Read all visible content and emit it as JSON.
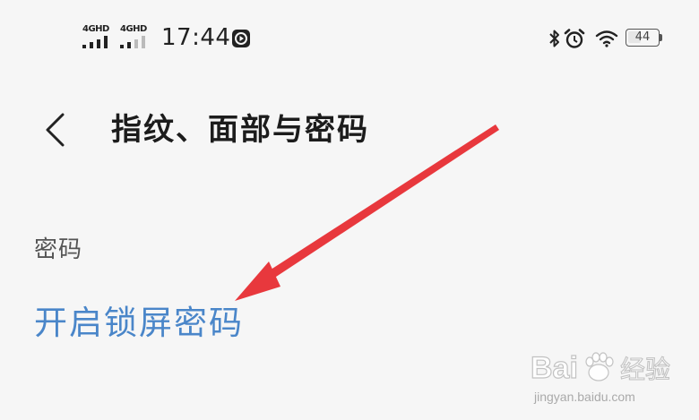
{
  "status_bar": {
    "sim1_label": "4GHD",
    "sim2_label": "4GHD",
    "time": "17:44",
    "battery_level": "44",
    "icons": [
      "signal-icon",
      "signal-icon",
      "media-play-icon",
      "bluetooth-icon",
      "alarm-icon",
      "wifi-icon",
      "battery-icon"
    ]
  },
  "header": {
    "back_icon": "chevron-left-icon",
    "title": "指纹、面部与密码"
  },
  "section": {
    "label": "密码",
    "enable_lock_link": "开启锁屏密码"
  },
  "annotation": {
    "arrow_color": "#e8383d"
  },
  "watermark": {
    "logo_text": "Bai",
    "logo_suffix": "经验",
    "url": "jingyan.baidu.com"
  },
  "colors": {
    "background": "#f6f6f6",
    "link": "#4a86c9",
    "title": "#1c1c1c",
    "arrow": "#e8383d"
  }
}
